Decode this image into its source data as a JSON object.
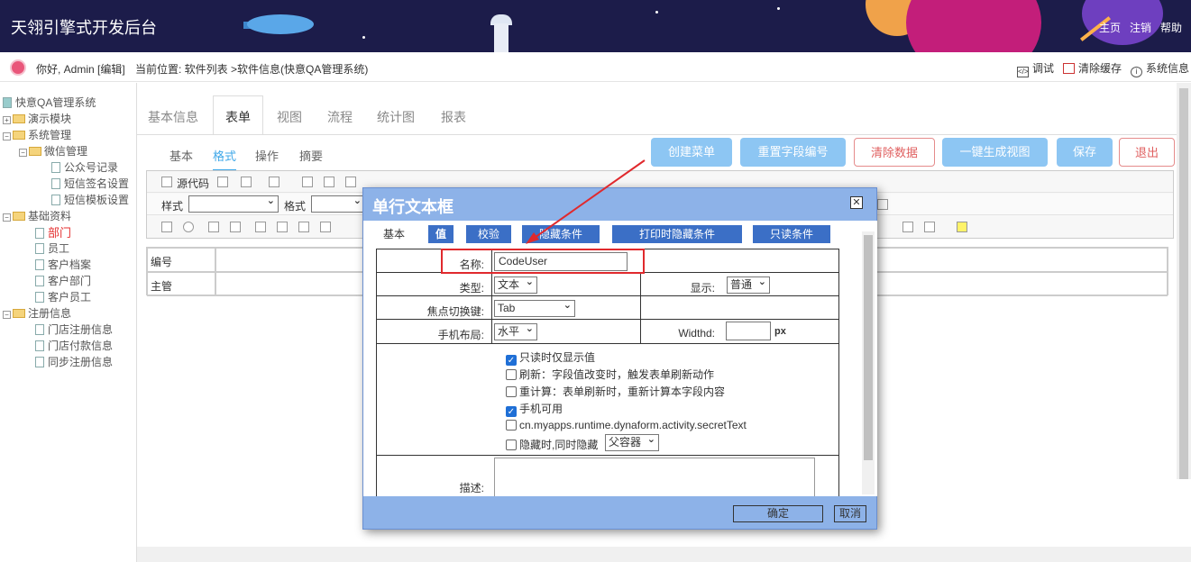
{
  "header": {
    "title": "天翎引擎式开发后台",
    "nav": [
      "主页",
      "注销",
      "帮助"
    ]
  },
  "bar": {
    "greeting": "你好, Admin [编辑]",
    "location": "当前位置: 软件列表 >软件信息(快意QA管理系统)",
    "tools": [
      "调试",
      "清除缓存",
      "系统信息"
    ]
  },
  "tree": {
    "root": "快意QA管理系统",
    "items": [
      "演示模块",
      "系统管理",
      "微信管理",
      "公众号记录",
      "短信签名设置",
      "短信模板设置",
      "基础资料",
      "部门",
      "员工",
      "客户档案",
      "客户部门",
      "客户员工",
      "注册信息",
      "门店注册信息",
      "门店付款信息",
      "同步注册信息"
    ]
  },
  "tabs": [
    "基本信息",
    "表单",
    "视图",
    "流程",
    "统计图",
    "报表"
  ],
  "subtabs": [
    "基本",
    "格式",
    "操作",
    "摘要"
  ],
  "buttons": [
    "创建菜单",
    "重置字段编号",
    "清除数据",
    "一键生成视图",
    "保存",
    "退出"
  ],
  "toolbar": {
    "source_label": "源代码",
    "style_label": "样式",
    "format_label": "格式"
  },
  "form": {
    "row1_label": "编号",
    "row2_label": "主管"
  },
  "dialog": {
    "title": "单行文本框",
    "tabs": [
      "基本",
      "值",
      "校验",
      "隐藏条件",
      "打印时隐藏条件",
      "只读条件"
    ],
    "name_label": "名称:",
    "name_value": "CodeUser",
    "type_label": "类型:",
    "type_value": "文本",
    "display_label": "显示:",
    "display_value": "普通",
    "focus_label": "焦点切换键:",
    "focus_value": "Tab",
    "mobile_label": "手机布局:",
    "mobile_value": "水平",
    "width_label": "Widthd:",
    "width_unit": "px",
    "checks": [
      {
        "label": "只读时仅显示值",
        "checked": true
      },
      {
        "label": "刷新：字段值改变时，触发表单刷新动作",
        "checked": false
      },
      {
        "label": "重计算：表单刷新时，重新计算本字段内容",
        "checked": false
      },
      {
        "label": "手机可用",
        "checked": true
      },
      {
        "label": "cn.myapps.runtime.dynaform.activity.secretText",
        "checked": false
      },
      {
        "label": "隐藏时,同时隐藏",
        "checked": false
      }
    ],
    "hide_target_value": "父容器",
    "desc_label": "描述:",
    "ok_label": "确定",
    "cancel_label": "取消"
  },
  "colors": {
    "header_bg": "#1c1c4a",
    "dialog_bg": "#8db2e8",
    "dialog_tab": "#3b6fc6",
    "button_blue": "#8dc6f3",
    "highlight_red": "#e0292d",
    "active_tab": "#3ea7e8"
  }
}
